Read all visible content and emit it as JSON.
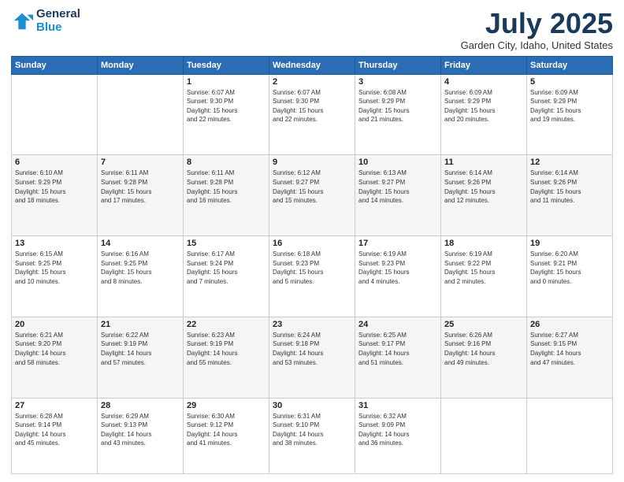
{
  "header": {
    "logo_general": "General",
    "logo_blue": "Blue",
    "title": "July 2025",
    "location": "Garden City, Idaho, United States"
  },
  "days_of_week": [
    "Sunday",
    "Monday",
    "Tuesday",
    "Wednesday",
    "Thursday",
    "Friday",
    "Saturday"
  ],
  "weeks": [
    [
      {
        "day": "",
        "info": ""
      },
      {
        "day": "",
        "info": ""
      },
      {
        "day": "1",
        "info": "Sunrise: 6:07 AM\nSunset: 9:30 PM\nDaylight: 15 hours\nand 22 minutes."
      },
      {
        "day": "2",
        "info": "Sunrise: 6:07 AM\nSunset: 9:30 PM\nDaylight: 15 hours\nand 22 minutes."
      },
      {
        "day": "3",
        "info": "Sunrise: 6:08 AM\nSunset: 9:29 PM\nDaylight: 15 hours\nand 21 minutes."
      },
      {
        "day": "4",
        "info": "Sunrise: 6:09 AM\nSunset: 9:29 PM\nDaylight: 15 hours\nand 20 minutes."
      },
      {
        "day": "5",
        "info": "Sunrise: 6:09 AM\nSunset: 9:29 PM\nDaylight: 15 hours\nand 19 minutes."
      }
    ],
    [
      {
        "day": "6",
        "info": "Sunrise: 6:10 AM\nSunset: 9:29 PM\nDaylight: 15 hours\nand 18 minutes."
      },
      {
        "day": "7",
        "info": "Sunrise: 6:11 AM\nSunset: 9:28 PM\nDaylight: 15 hours\nand 17 minutes."
      },
      {
        "day": "8",
        "info": "Sunrise: 6:11 AM\nSunset: 9:28 PM\nDaylight: 15 hours\nand 16 minutes."
      },
      {
        "day": "9",
        "info": "Sunrise: 6:12 AM\nSunset: 9:27 PM\nDaylight: 15 hours\nand 15 minutes."
      },
      {
        "day": "10",
        "info": "Sunrise: 6:13 AM\nSunset: 9:27 PM\nDaylight: 15 hours\nand 14 minutes."
      },
      {
        "day": "11",
        "info": "Sunrise: 6:14 AM\nSunset: 9:26 PM\nDaylight: 15 hours\nand 12 minutes."
      },
      {
        "day": "12",
        "info": "Sunrise: 6:14 AM\nSunset: 9:26 PM\nDaylight: 15 hours\nand 11 minutes."
      }
    ],
    [
      {
        "day": "13",
        "info": "Sunrise: 6:15 AM\nSunset: 9:25 PM\nDaylight: 15 hours\nand 10 minutes."
      },
      {
        "day": "14",
        "info": "Sunrise: 6:16 AM\nSunset: 9:25 PM\nDaylight: 15 hours\nand 8 minutes."
      },
      {
        "day": "15",
        "info": "Sunrise: 6:17 AM\nSunset: 9:24 PM\nDaylight: 15 hours\nand 7 minutes."
      },
      {
        "day": "16",
        "info": "Sunrise: 6:18 AM\nSunset: 9:23 PM\nDaylight: 15 hours\nand 5 minutes."
      },
      {
        "day": "17",
        "info": "Sunrise: 6:19 AM\nSunset: 9:23 PM\nDaylight: 15 hours\nand 4 minutes."
      },
      {
        "day": "18",
        "info": "Sunrise: 6:19 AM\nSunset: 9:22 PM\nDaylight: 15 hours\nand 2 minutes."
      },
      {
        "day": "19",
        "info": "Sunrise: 6:20 AM\nSunset: 9:21 PM\nDaylight: 15 hours\nand 0 minutes."
      }
    ],
    [
      {
        "day": "20",
        "info": "Sunrise: 6:21 AM\nSunset: 9:20 PM\nDaylight: 14 hours\nand 58 minutes."
      },
      {
        "day": "21",
        "info": "Sunrise: 6:22 AM\nSunset: 9:19 PM\nDaylight: 14 hours\nand 57 minutes."
      },
      {
        "day": "22",
        "info": "Sunrise: 6:23 AM\nSunset: 9:19 PM\nDaylight: 14 hours\nand 55 minutes."
      },
      {
        "day": "23",
        "info": "Sunrise: 6:24 AM\nSunset: 9:18 PM\nDaylight: 14 hours\nand 53 minutes."
      },
      {
        "day": "24",
        "info": "Sunrise: 6:25 AM\nSunset: 9:17 PM\nDaylight: 14 hours\nand 51 minutes."
      },
      {
        "day": "25",
        "info": "Sunrise: 6:26 AM\nSunset: 9:16 PM\nDaylight: 14 hours\nand 49 minutes."
      },
      {
        "day": "26",
        "info": "Sunrise: 6:27 AM\nSunset: 9:15 PM\nDaylight: 14 hours\nand 47 minutes."
      }
    ],
    [
      {
        "day": "27",
        "info": "Sunrise: 6:28 AM\nSunset: 9:14 PM\nDaylight: 14 hours\nand 45 minutes."
      },
      {
        "day": "28",
        "info": "Sunrise: 6:29 AM\nSunset: 9:13 PM\nDaylight: 14 hours\nand 43 minutes."
      },
      {
        "day": "29",
        "info": "Sunrise: 6:30 AM\nSunset: 9:12 PM\nDaylight: 14 hours\nand 41 minutes."
      },
      {
        "day": "30",
        "info": "Sunrise: 6:31 AM\nSunset: 9:10 PM\nDaylight: 14 hours\nand 38 minutes."
      },
      {
        "day": "31",
        "info": "Sunrise: 6:32 AM\nSunset: 9:09 PM\nDaylight: 14 hours\nand 36 minutes."
      },
      {
        "day": "",
        "info": ""
      },
      {
        "day": "",
        "info": ""
      }
    ]
  ]
}
